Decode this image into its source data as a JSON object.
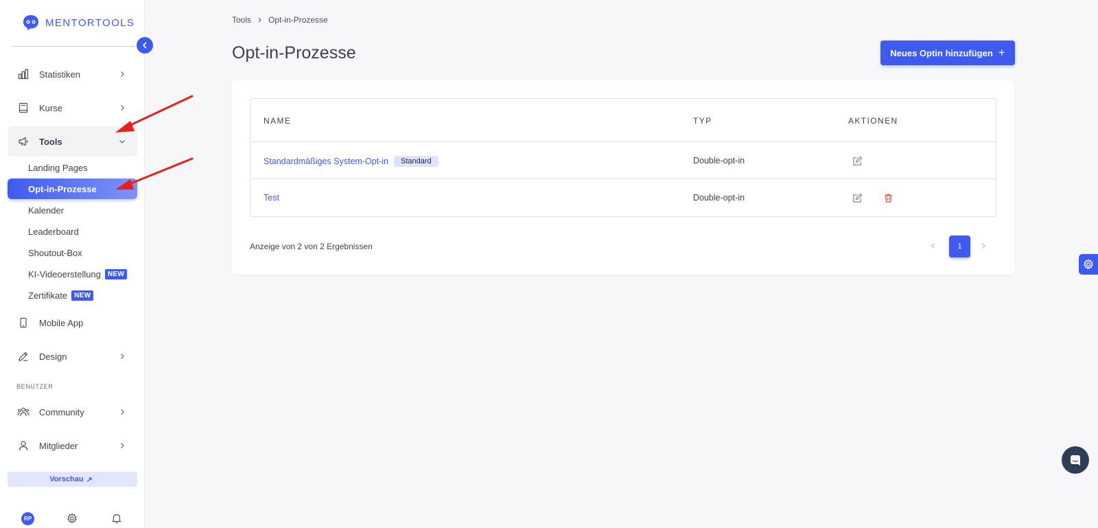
{
  "app": {
    "logo_text": "MENTORTOOLS"
  },
  "sidebar": {
    "items": [
      {
        "label": "Statistiken",
        "icon": "bar-chart-icon"
      },
      {
        "label": "Kurse",
        "icon": "book-icon"
      },
      {
        "label": "Tools",
        "icon": "megaphone-icon"
      },
      {
        "label": "Mobile App",
        "icon": "phone-icon"
      },
      {
        "label": "Design",
        "icon": "pencil-icon"
      },
      {
        "label": "Community",
        "icon": "users-icon"
      },
      {
        "label": "Mitglieder",
        "icon": "user-icon"
      }
    ],
    "tools_sub": [
      {
        "label": "Landing Pages"
      },
      {
        "label": "Opt-in-Prozesse"
      },
      {
        "label": "Kalender"
      },
      {
        "label": "Leaderboard"
      },
      {
        "label": "Shoutout-Box"
      },
      {
        "label": "KI-Videoerstellung",
        "badge": "NEW"
      },
      {
        "label": "Zertifikate",
        "badge": "NEW"
      }
    ],
    "section_users": "BENUTZER",
    "preview_label": "Vorschau",
    "preview_icon": "↗",
    "avatar_initials": "RP"
  },
  "breadcrumb": {
    "root": "Tools",
    "separator": "›",
    "current": "Opt-in-Prozesse"
  },
  "page": {
    "title": "Opt-in-Prozesse",
    "add_button_label": "Neues Optin hinzufügen",
    "add_button_icon": "+"
  },
  "table": {
    "headers": {
      "name": "NAME",
      "type": "TYP",
      "actions": "AKTIONEN"
    },
    "rows": [
      {
        "name": "Standardmäßiges System-Opt-in",
        "badge": "Standard",
        "type": "Double-opt-in"
      },
      {
        "name": "Test",
        "type": "Double-opt-in"
      }
    ]
  },
  "pagination": {
    "summary": "Anzeige von 2 von 2 Ergebnissen",
    "current_page": "1"
  },
  "colors": {
    "accent": "#3f5bef",
    "danger": "#e53935",
    "annotation_arrow": "#e8201b"
  }
}
